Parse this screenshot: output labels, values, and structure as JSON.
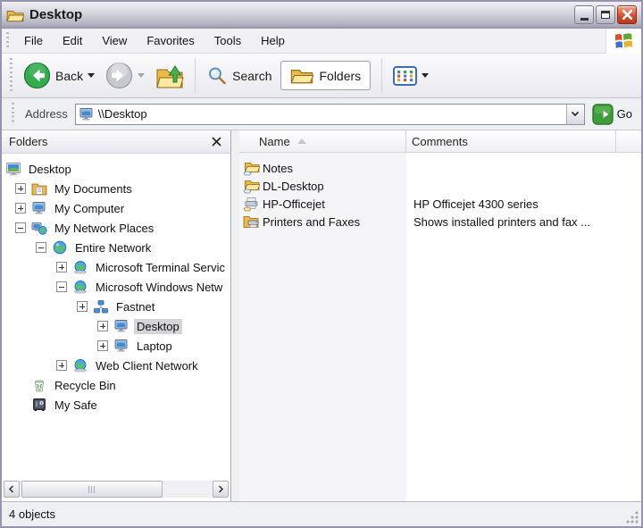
{
  "window": {
    "title": "Desktop"
  },
  "titlebar": {
    "icon": "open-folder-icon"
  },
  "menu": {
    "items": [
      {
        "label": "File"
      },
      {
        "label": "Edit"
      },
      {
        "label": "View"
      },
      {
        "label": "Favorites"
      },
      {
        "label": "Tools"
      },
      {
        "label": "Help"
      }
    ],
    "logo_icon": "windows-logo-icon"
  },
  "toolbar": {
    "back": {
      "label": "Back",
      "icon": "back-arrow-icon"
    },
    "forward": {
      "icon": "forward-arrow-icon",
      "disabled": true
    },
    "up": {
      "icon": "up-folder-icon"
    },
    "search": {
      "label": "Search",
      "icon": "search-icon"
    },
    "folders": {
      "label": "Folders",
      "icon": "folders-icon",
      "pressed": true
    },
    "views": {
      "icon": "views-icon"
    }
  },
  "addressbar": {
    "label": "Address",
    "value": "\\\\Desktop",
    "field_icon": "computer-icon",
    "dropdown_icon": "chevron-down-icon",
    "go_icon": "go-arrow-icon",
    "go_label": "Go"
  },
  "left_pane": {
    "header": "Folders",
    "close_icon": "close-icon"
  },
  "tree": {
    "items": [
      {
        "level": 0,
        "expand": "root",
        "icon": "desktop-root-icon",
        "label": "Desktop",
        "selected": false
      },
      {
        "level": 1,
        "expand": "plus",
        "icon": "my-documents-icon",
        "label": "My Documents",
        "selected": false
      },
      {
        "level": 1,
        "expand": "plus",
        "icon": "my-computer-icon",
        "label": "My Computer",
        "selected": false
      },
      {
        "level": 1,
        "expand": "minus",
        "icon": "network-places-icon",
        "label": "My Network Places",
        "selected": false
      },
      {
        "level": 2,
        "expand": "minus",
        "icon": "globe-icon",
        "label": "Entire Network",
        "selected": false
      },
      {
        "level": 3,
        "expand": "plus",
        "icon": "network-provider-icon",
        "label": "Microsoft Terminal Servic",
        "selected": false
      },
      {
        "level": 3,
        "expand": "minus",
        "icon": "network-provider-icon",
        "label": "Microsoft Windows Netw",
        "selected": false
      },
      {
        "level": 4,
        "expand": "plus",
        "icon": "workgroup-icon",
        "label": "Fastnet",
        "selected": false
      },
      {
        "level": 5,
        "expand": "plus",
        "icon": "computer-icon",
        "label": "Desktop",
        "selected": true
      },
      {
        "level": 5,
        "expand": "plus",
        "icon": "computer-icon",
        "label": "Laptop",
        "selected": false
      },
      {
        "level": 3,
        "expand": "plus",
        "icon": "network-provider-icon",
        "label": "Web Client Network",
        "selected": false
      },
      {
        "level": 1,
        "expand": "none",
        "icon": "recycle-bin-icon",
        "label": "Recycle Bin",
        "selected": false
      },
      {
        "level": 1,
        "expand": "none",
        "icon": "safe-icon",
        "label": "My Safe",
        "selected": false
      }
    ]
  },
  "right_pane": {
    "columns": [
      {
        "label": "Name",
        "sorted": "asc"
      },
      {
        "label": "Comments"
      }
    ],
    "items": [
      {
        "icon": "shared-folder-icon",
        "name": "Notes",
        "comments": ""
      },
      {
        "icon": "shared-folder-icon",
        "name": "DL-Desktop",
        "comments": ""
      },
      {
        "icon": "shared-printer-icon",
        "name": "HP-Officejet",
        "comments": "HP Officejet 4300 series"
      },
      {
        "icon": "printers-folder-icon",
        "name": "Printers and Faxes",
        "comments": "Shows installed printers and fax ..."
      }
    ]
  },
  "statusbar": {
    "text": "4 objects"
  },
  "colors": {
    "accent_green": "#35ac4e",
    "close_red": "#da4f30",
    "selection_gray": "#d4d4d9",
    "chrome": "#eef0f2"
  }
}
